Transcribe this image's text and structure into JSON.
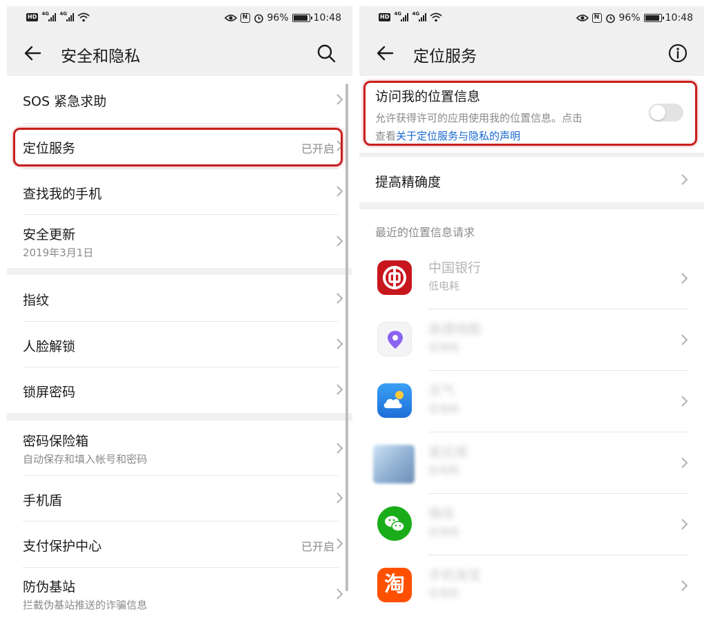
{
  "status_bar": {
    "hd": "HD",
    "net1": "4G",
    "net2": "4G",
    "battery": "96%",
    "time": "10:48",
    "nfc": "N"
  },
  "left": {
    "title": "安全和隐私",
    "items": [
      {
        "label": "SOS 紧急求助"
      },
      {
        "label": "定位服务",
        "value": "已开启"
      },
      {
        "label": "查找我的手机"
      },
      {
        "label": "安全更新",
        "sub": "2019年3月1日"
      },
      {
        "label": "指纹"
      },
      {
        "label": "人脸解锁"
      },
      {
        "label": "锁屏密码"
      },
      {
        "label": "密码保险箱",
        "sub": "自动保存和填入帐号和密码"
      },
      {
        "label": "手机盾"
      },
      {
        "label": "支付保护中心",
        "value": "已开启"
      },
      {
        "label": "防伪基站",
        "sub": "拦截伪基站推送的诈骗信息"
      }
    ]
  },
  "right": {
    "title": "定位服务",
    "access": {
      "label": "访问我的位置信息",
      "desc_line1": "允许获得许可的应用使用我的位置信息。点击",
      "desc_prefix": "查看",
      "desc_link": "关于定位服务与隐私的声明",
      "enabled": false
    },
    "accuracy_label": "提高精确度",
    "recent_header": "最近的位置信息请求",
    "apps": [
      {
        "name": "中国银行",
        "sub": "低电耗",
        "icon": "boc-icon",
        "color": "#c8161d"
      },
      {
        "name": "高德地图",
        "sub": "低电耗",
        "icon": "map-pin-icon",
        "color": "#7b61ff"
      },
      {
        "name": "天气",
        "sub": "低电耗",
        "icon": "weather-icon",
        "color": "#2f8cf0"
      },
      {
        "name": "某应用",
        "sub": "低电耗",
        "icon": "blurred-app-icon",
        "color": "#9ab8d8"
      },
      {
        "name": "微信",
        "sub": "低电耗",
        "icon": "wechat-icon",
        "color": "#1aad19"
      },
      {
        "name": "手机淘宝",
        "sub": "低电耗",
        "icon": "taobao-icon",
        "color": "#ff5000"
      }
    ]
  },
  "colors": {
    "highlight": "#c81e1e",
    "link": "#1868d0",
    "secondary_text": "#8a8a8a"
  }
}
